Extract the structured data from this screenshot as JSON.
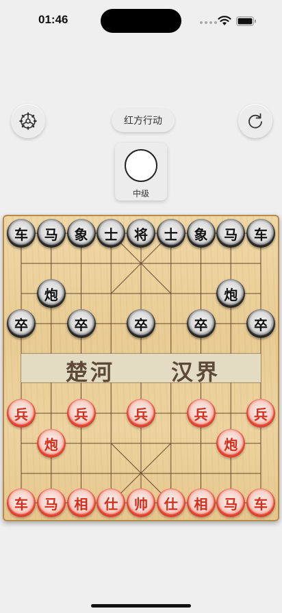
{
  "status_bar": {
    "time": "01:46"
  },
  "top_bar": {
    "turn_label": "红方行动",
    "level_label": "中级"
  },
  "river": {
    "left_text": "楚河",
    "right_text": "汉界"
  },
  "pieces": {
    "black": [
      {
        "name": "black-chariot-left",
        "label": "车"
      },
      {
        "name": "black-horse-left",
        "label": "马"
      },
      {
        "name": "black-elephant-left",
        "label": "象"
      },
      {
        "name": "black-advisor-left",
        "label": "士"
      },
      {
        "name": "black-general",
        "label": "将"
      },
      {
        "name": "black-advisor-right",
        "label": "士"
      },
      {
        "name": "black-elephant-right",
        "label": "象"
      },
      {
        "name": "black-horse-right",
        "label": "马"
      },
      {
        "name": "black-chariot-right",
        "label": "车"
      },
      {
        "name": "black-cannon-left",
        "label": "炮"
      },
      {
        "name": "black-cannon-right",
        "label": "炮"
      },
      {
        "name": "black-soldier-1",
        "label": "卒"
      },
      {
        "name": "black-soldier-2",
        "label": "卒"
      },
      {
        "name": "black-soldier-3",
        "label": "卒"
      },
      {
        "name": "black-soldier-4",
        "label": "卒"
      },
      {
        "name": "black-soldier-5",
        "label": "卒"
      }
    ],
    "red": [
      {
        "name": "red-soldier-1",
        "label": "兵"
      },
      {
        "name": "red-soldier-2",
        "label": "兵"
      },
      {
        "name": "red-soldier-3",
        "label": "兵"
      },
      {
        "name": "red-soldier-4",
        "label": "兵"
      },
      {
        "name": "red-soldier-5",
        "label": "兵"
      },
      {
        "name": "red-cannon-left",
        "label": "炮"
      },
      {
        "name": "red-cannon-right",
        "label": "炮"
      },
      {
        "name": "red-chariot-left",
        "label": "车"
      },
      {
        "name": "red-horse-left",
        "label": "马"
      },
      {
        "name": "red-elephant-left",
        "label": "相"
      },
      {
        "name": "red-advisor-left",
        "label": "仕"
      },
      {
        "name": "red-general",
        "label": "帅"
      },
      {
        "name": "red-advisor-right",
        "label": "仕"
      },
      {
        "name": "red-elephant-right",
        "label": "相"
      },
      {
        "name": "red-horse-right",
        "label": "马"
      },
      {
        "name": "red-chariot-right",
        "label": "车"
      }
    ]
  },
  "icons": {
    "settings": "settings-gear-icon",
    "restart": "restart-icon"
  }
}
